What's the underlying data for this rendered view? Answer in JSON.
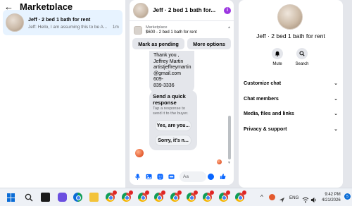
{
  "left_panel": {
    "title": "Marketplace",
    "conversation": {
      "name": "Jeff · 2 bed 1 bath for rent",
      "preview": "Jeff: Hello, I am assuming this to be A...",
      "time": "1m"
    }
  },
  "chat": {
    "title": "Jeff · 2 bed 1 bath for...",
    "listing": {
      "source": "Marketplace",
      "text": "$600 - 2 bed 1 bath for rent"
    },
    "actions": {
      "pending": "Mark as pending",
      "options": "More options"
    },
    "message_lines": [
      "Thank you ,",
      "Jeffrey Martin",
      "artistjeffreymartin",
      "@gmail.com 609-",
      "839-3336"
    ],
    "quick_response": {
      "title": "Send a quick response",
      "subtitle": "Tap a response to send it to the buyer.",
      "options": [
        "Yes, are you...",
        "Sorry, it's n..."
      ]
    },
    "composer": {
      "placeholder": "Aa"
    }
  },
  "right_panel": {
    "name": "Jeff · 2 bed 1 bath for rent",
    "mute_label": "Mute",
    "search_label": "Search",
    "menu": [
      "Customize chat",
      "Chat members",
      "Media, files and links",
      "Privacy & support"
    ]
  },
  "taskbar": {
    "language": "ENG",
    "time": "9:42 PM",
    "date": "4/21/2026",
    "notification_count": "5"
  },
  "colors": {
    "accent": "#0866ff",
    "selected_conversation": "#e7f3ff",
    "bubble": "#e4e6eb",
    "info_icon": "#9b36e0"
  }
}
